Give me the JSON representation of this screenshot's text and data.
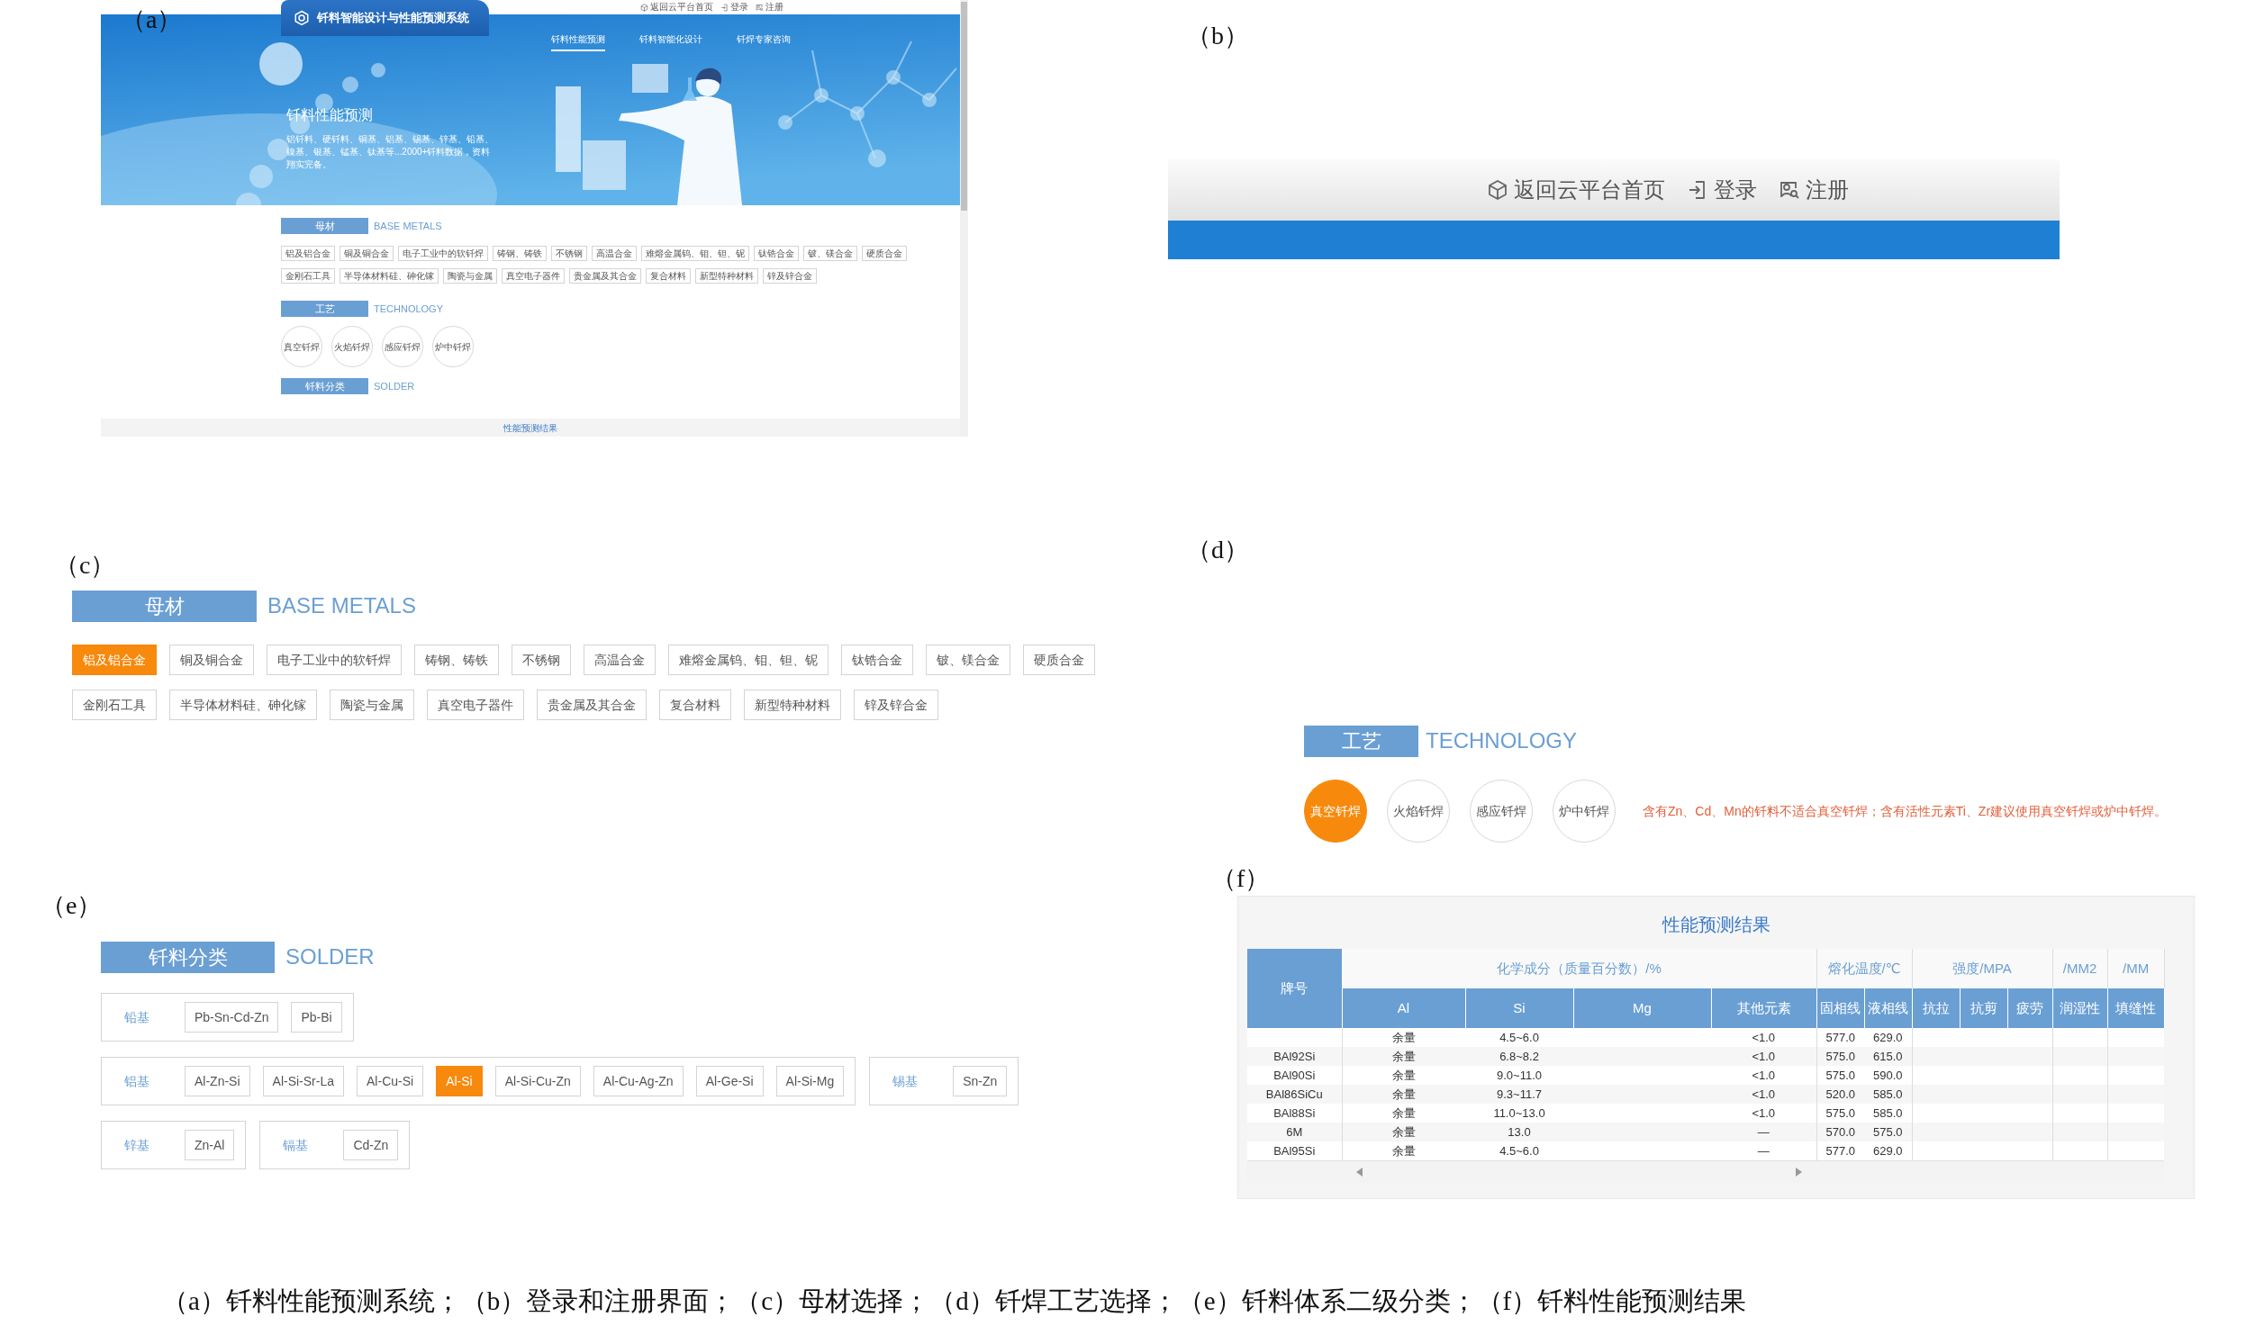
{
  "panel_a": {
    "label": "（a）",
    "top_links": [
      "返回云平台首页",
      "登录",
      "注册"
    ],
    "system_title": "钎料智能设计与性能预测系统",
    "nav": [
      {
        "label": "钎料性能预测",
        "selected": true
      },
      {
        "label": "钎料智能化设计",
        "selected": false
      },
      {
        "label": "钎焊专家咨询",
        "selected": false
      }
    ],
    "hero_title": "钎料性能预测",
    "hero_text": "铝钎料、硬钎料、铜基、铝基、锡基、锌基、铅基、镍基、银基、锰基、钛基等...2000+钎料数据，资料翔实完备。",
    "base_metals": {
      "title": "母材",
      "subtitle": "BASE METALS",
      "tags": [
        {
          "label": "铝及铝合金",
          "selected": false
        },
        {
          "label": "铜及铜合金",
          "selected": false
        },
        {
          "label": "电子工业中的软钎焊",
          "selected": false
        },
        {
          "label": "铸钢、铸铁",
          "selected": false
        },
        {
          "label": "不锈钢",
          "selected": false
        },
        {
          "label": "高温合金",
          "selected": false
        },
        {
          "label": "难熔金属钨、钼、钽、铌",
          "selected": false
        },
        {
          "label": "钛锆合金",
          "selected": false
        },
        {
          "label": "铍、镁合金",
          "selected": false
        },
        {
          "label": "硬质合金",
          "selected": false
        },
        {
          "label": "金刚石工具",
          "selected": false
        },
        {
          "label": "半导体材料硅、砷化镓",
          "selected": false
        },
        {
          "label": "陶瓷与金属",
          "selected": false
        },
        {
          "label": "真空电子器件",
          "selected": false
        },
        {
          "label": "贵金属及其合金",
          "selected": false
        },
        {
          "label": "复合材料",
          "selected": false
        },
        {
          "label": "新型特种材料",
          "selected": false
        },
        {
          "label": "锌及锌合金",
          "selected": false
        }
      ]
    },
    "technology": {
      "title": "工艺",
      "subtitle": "TECHNOLOGY",
      "methods": [
        {
          "label": "真空钎焊",
          "selected": false
        },
        {
          "label": "火焰钎焊",
          "selected": false
        },
        {
          "label": "感应钎焊",
          "selected": false
        },
        {
          "label": "炉中钎焊",
          "selected": false
        }
      ]
    },
    "solder": {
      "title": "钎料分类",
      "subtitle": "SOLDER"
    },
    "footer_link": "性能预测结果"
  },
  "panel_b": {
    "label": "（b）",
    "links": [
      "返回云平台首页",
      "登录",
      "注册"
    ]
  },
  "panel_c": {
    "label": "（c）",
    "title": "母材",
    "subtitle": "BASE METALS",
    "tags": [
      {
        "label": "铝及铝合金",
        "selected": true
      },
      {
        "label": "铜及铜合金",
        "selected": false
      },
      {
        "label": "电子工业中的软钎焊",
        "selected": false
      },
      {
        "label": "铸钢、铸铁",
        "selected": false
      },
      {
        "label": "不锈钢",
        "selected": false
      },
      {
        "label": "高温合金",
        "selected": false
      },
      {
        "label": "难熔金属钨、钼、钽、铌",
        "selected": false
      },
      {
        "label": "钛锆合金",
        "selected": false
      },
      {
        "label": "铍、镁合金",
        "selected": false
      },
      {
        "label": "硬质合金",
        "selected": false
      },
      {
        "label": "金刚石工具",
        "selected": false
      },
      {
        "label": "半导体材料硅、砷化镓",
        "selected": false
      },
      {
        "label": "陶瓷与金属",
        "selected": false
      },
      {
        "label": "真空电子器件",
        "selected": false
      },
      {
        "label": "贵金属及其合金",
        "selected": false
      },
      {
        "label": "复合材料",
        "selected": false
      },
      {
        "label": "新型特种材料",
        "selected": false
      },
      {
        "label": "锌及锌合金",
        "selected": false
      }
    ]
  },
  "panel_d": {
    "label": "（d）",
    "title": "工艺",
    "subtitle": "TECHNOLOGY",
    "methods": [
      {
        "label": "真空钎焊",
        "selected": true
      },
      {
        "label": "火焰钎焊",
        "selected": false
      },
      {
        "label": "感应钎焊",
        "selected": false
      },
      {
        "label": "炉中钎焊",
        "selected": false
      }
    ],
    "note": "含有Zn、Cd、Mn的钎料不适合真空钎焊；含有活性元素Ti、Zr建议使用真空钎焊或炉中钎焊。"
  },
  "panel_e": {
    "label": "（e）",
    "title": "钎料分类",
    "subtitle": "SOLDER",
    "groups": [
      {
        "base": "铅基",
        "tags": [
          {
            "label": "Pb-Sn-Cd-Zn",
            "selected": false
          },
          {
            "label": "Pb-Bi",
            "selected": false
          }
        ]
      },
      {
        "base": "铝基",
        "tags": [
          {
            "label": "Al-Zn-Si",
            "selected": false
          },
          {
            "label": "Al-Si-Sr-La",
            "selected": false
          },
          {
            "label": "Al-Cu-Si",
            "selected": false
          },
          {
            "label": "Al-Si",
            "selected": true
          },
          {
            "label": "Al-Si-Cu-Zn",
            "selected": false
          },
          {
            "label": "Al-Cu-Ag-Zn",
            "selected": false
          },
          {
            "label": "Al-Ge-Si",
            "selected": false
          },
          {
            "label": "Al-Si-Mg",
            "selected": false
          }
        ]
      },
      {
        "base": "锡基",
        "tags": [
          {
            "label": "Sn-Zn",
            "selected": false
          }
        ]
      },
      {
        "base": "锌基",
        "tags": [
          {
            "label": "Zn-Al",
            "selected": false
          }
        ]
      },
      {
        "base": "镉基",
        "tags": [
          {
            "label": "Cd-Zn",
            "selected": false
          }
        ]
      }
    ]
  },
  "panel_f": {
    "label": "（f）",
    "title": "性能预测结果",
    "table": {
      "key_header": "牌号",
      "group_headers": [
        "化学成分（质量百分数）/%",
        "熔化温度/℃",
        "强度/MPA",
        "/MM2",
        "/MM"
      ],
      "columns": [
        "Al",
        "Si",
        "Mg",
        "其他元素",
        "固相线",
        "液相线",
        "抗拉",
        "抗剪",
        "疲劳",
        "润湿性",
        "填缝性"
      ],
      "rows": [
        {
          "Al": "余量",
          "Si": "4.5~6.0",
          "other": "<1.0",
          "solidus": "577.0",
          "liquidus": "629.0"
        },
        {
          "grade": "BAl92Si",
          "Al": "余量",
          "Si": "6.8~8.2",
          "other": "<1.0",
          "solidus": "575.0",
          "liquidus": "615.0"
        },
        {
          "grade": "BAl90Si",
          "Al": "余量",
          "Si": "9.0~11.0",
          "other": "<1.0",
          "solidus": "575.0",
          "liquidus": "590.0"
        },
        {
          "grade": "BAl86SiCu",
          "Al": "余量",
          "Si": "9.3~11.7",
          "other": "<1.0",
          "solidus": "520.0",
          "liquidus": "585.0"
        },
        {
          "grade": "BAl88Si",
          "Al": "余量",
          "Si": "11.0~13.0",
          "other": "<1.0",
          "solidus": "575.0",
          "liquidus": "585.0"
        },
        {
          "grade": "6M",
          "Al": "余量",
          "Si": "13.0",
          "other": "—",
          "solidus": "570.0",
          "liquidus": "575.0"
        },
        {
          "grade": "BAl95Si",
          "Al": "余量",
          "Si": "4.5~6.0",
          "other": "—",
          "solidus": "577.0",
          "liquidus": "629.0"
        }
      ]
    }
  },
  "caption": "（a）钎料性能预测系统；（b）登录和注册界面；（c）母材选择；（d）钎焊工艺选择；（e）钎料体系二级分类；（f）钎料性能预测结果"
}
